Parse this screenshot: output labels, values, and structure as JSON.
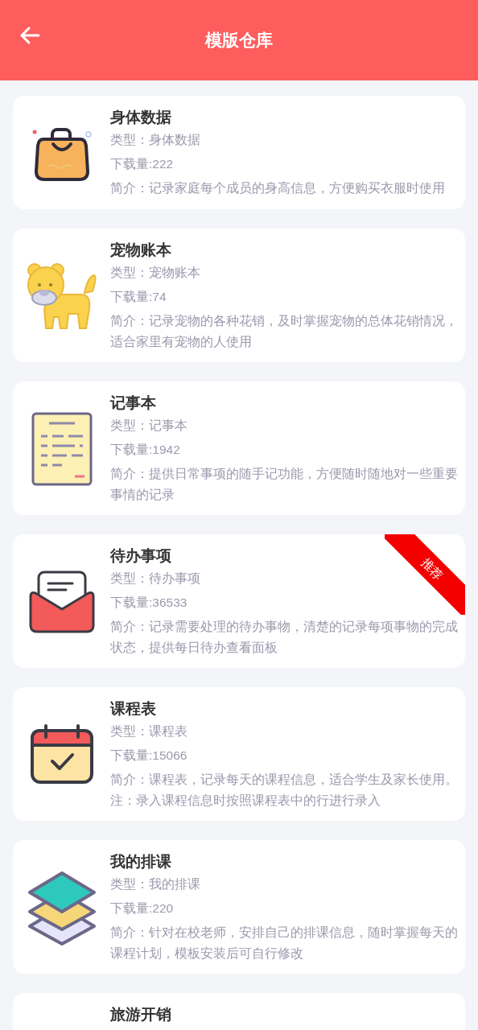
{
  "header": {
    "title": "模版仓库"
  },
  "templates": [
    {
      "kind": "bag",
      "title": "身体数据",
      "type": "类型：身体数据",
      "downloads": "下载量:222",
      "intro": "简介：记录家庭每个成员的身高信息，方便购买衣服时使用"
    },
    {
      "kind": "pet",
      "title": "宠物账本",
      "type": "类型：宠物账本",
      "downloads": "下载量:74",
      "intro": "简介：记录宠物的各种花销，及时掌握宠物的总体花销情况，适合家里有宠物的人使用"
    },
    {
      "kind": "notepad",
      "title": "记事本",
      "type": "类型：记事本",
      "downloads": "下载量:1942",
      "intro": "简介：提供日常事项的随手记功能，方便随时随地对一些重要事情的记录"
    },
    {
      "kind": "envelope",
      "title": "待办事项",
      "type": "类型：待办事项",
      "downloads": "下载量:36533",
      "intro": "简介：记录需要处理的待办事物，清楚的记录每项事物的完成状态，提供每日待办查看面板",
      "ribbon": "推荐"
    },
    {
      "kind": "calendar",
      "title": "课程表",
      "type": "类型：课程表",
      "downloads": "下载量:15066",
      "intro": "简介：课程表，记录每天的课程信息，适合学生及家长使用。注：录入课程信息时按照课程表中的行进行录入"
    },
    {
      "kind": "layers",
      "title": "我的排课",
      "type": "类型：我的排课",
      "downloads": "下载量:220",
      "intro": "简介：针对在校老师，安排自己的排课信息，随时掌握每天的课程计划，模板安装后可自行修改"
    },
    {
      "kind": "partial",
      "title": "旅游开销"
    }
  ]
}
